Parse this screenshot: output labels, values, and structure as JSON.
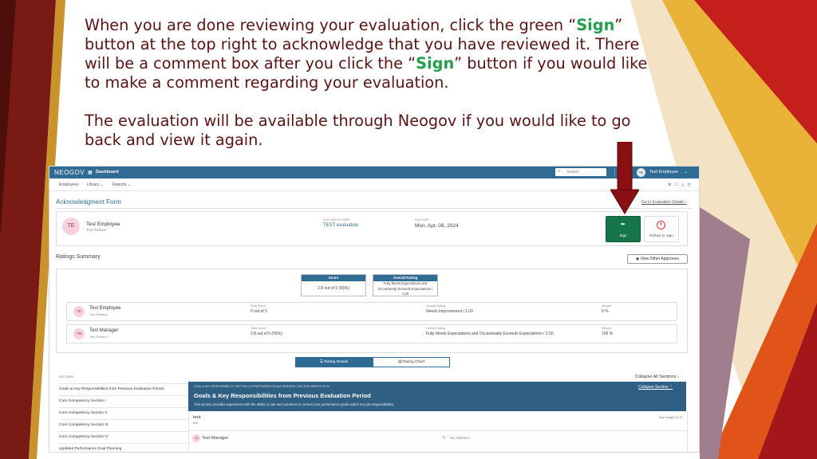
{
  "theme": {
    "maroon": "#5a1414",
    "sign_green": "#22a04b",
    "neogov_blue": "#2f6b93",
    "sign_button": "#16754a",
    "slide_red": "#c41f1a",
    "slide_gold": "#e9b33a"
  },
  "instructions": {
    "p1_part1": "When you are done reviewing your evaluation, click the green “",
    "sign_word": "Sign",
    "p1_part2": "” button at the top right to acknowledge that you have reviewed it. There will be a comment box after you click the “",
    "p1_part3": "” button if you would like to make a comment regarding your evaluation.",
    "p2": "The evaluation will be available through Neogov if you would like to go back and view it again."
  },
  "app": {
    "brand": "NEOGOV",
    "nav_title": "Dashboard",
    "search_placeholder": "Search",
    "user_initials": "TE",
    "user_name": "Test Employee",
    "subnav": [
      "Employees",
      "Library ⌄",
      "Reports ⌄"
    ],
    "page_title": "Acknowledgment Form",
    "go_to_eval_link": "Go to Evaluation Details ›"
  },
  "ack": {
    "initials": "TE",
    "name": "Test Employee",
    "position": "Test Position",
    "form_label": "EVALUATION FORM",
    "form_value": "TEST evaluation",
    "due_label": "DUE DATE",
    "due_value": "Mon, Apr. 08, 2024",
    "sign_label": "Sign",
    "refuse_label": "Refuse to Sign"
  },
  "ratings": {
    "title": "Ratings Summary",
    "view_other": "View Other Approvers",
    "score_header": "Score",
    "score_value": "2.8 out of 5 (56%)",
    "overall_header": "Overall Rating",
    "overall_value": "Fully Meets Expectations and Occasionally Exceeds Expectations / 3.50",
    "total_score_label": "Total Score",
    "overall_label": "Overall Rating",
    "weight_label": "Weight",
    "raters": [
      {
        "initials": "TE",
        "name": "Test Employee",
        "position": "Test Position",
        "total": "0 out of 5",
        "overall": "Needs Improvement / 1.00",
        "weight": "0 %"
      },
      {
        "initials": "TM",
        "name": "Test Manager",
        "position": "Test Position",
        "total": "2.8 out of 5 (56%)",
        "overall": "Fully Meets Expectations and Occasionally Exceeds Expectations / 3.50",
        "weight": "100 %"
      }
    ]
  },
  "tabs": {
    "rating_details": "Rating Details",
    "rating_chart": "Rating Chart"
  },
  "sections": {
    "header": "SECTIONS",
    "collapse_all": "Collapse All Sections ›",
    "items": [
      "Goals & Key Responsibilities from Previous Evaluation Period",
      "Core Competency Section I",
      "Core Competency Section II",
      "Core Competency Section III",
      "Core Competency Section IV",
      "Updated Performance Goal Planning"
    ]
  },
  "goal": {
    "meta": "GOAL & KEY RESPONSIBILITY SECTION | 5 POINT RATING SCALE UPDATED | SECTION WEIGHT 20 %",
    "title": "Goals & Key Responsibilities from Previous Evaluation Period",
    "description": "This section provides supervisors with the ability to rate and comment on current year performance goals and/or key job responsibilities.",
    "collapse": "Collapse Section ⌃",
    "item_title": "test",
    "item_sub": "test",
    "weight": "Item weight 20 %",
    "commenter_initials": "TM",
    "commenter": "Test Manager",
    "no_comment": "No comment"
  }
}
